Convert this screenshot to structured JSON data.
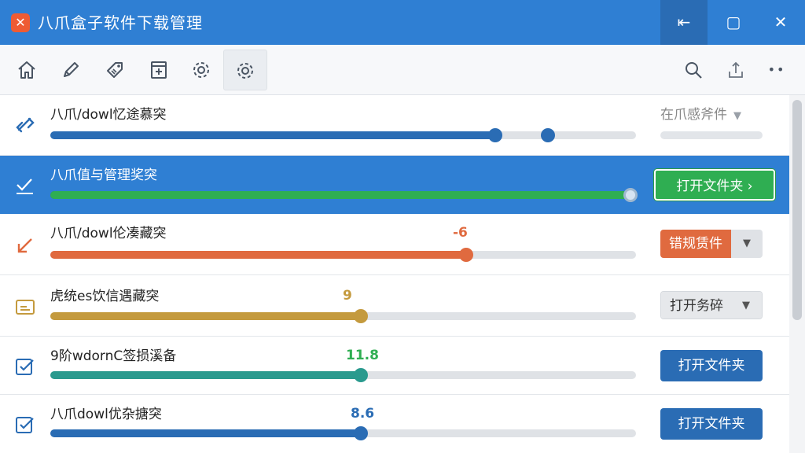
{
  "window": {
    "title": "八爪盒子软件下载管理",
    "logo_glyph": "✕",
    "controls": {
      "back": "⇤",
      "maximize": "▢",
      "close": "✕"
    }
  },
  "toolbar": {
    "items": [
      {
        "name": "home-icon"
      },
      {
        "name": "pencil-icon"
      },
      {
        "name": "tag-icon"
      },
      {
        "name": "add-file-icon"
      },
      {
        "name": "settings-icon"
      },
      {
        "name": "advanced-settings-icon",
        "active": true
      }
    ],
    "right": [
      {
        "name": "search-icon"
      },
      {
        "name": "upload-icon"
      },
      {
        "name": "more-icon",
        "glyph": "••"
      }
    ]
  },
  "rows": [
    {
      "name": "八爪/dowl忆途慕突",
      "progress_main": 0.76,
      "progress_secondary": 0.85,
      "percent_label": "",
      "color": "#2a6cb4",
      "action_type": "dropdown-plain",
      "action_label": "在爪感斧件"
    },
    {
      "name": "八爪值与管理奖突",
      "progress_main": 0.99,
      "percent_label": "",
      "color": "#2fae52",
      "action_type": "button-green",
      "action_label": "打开文件夹 ›"
    },
    {
      "name": "八爪/dowl伦凑藏突",
      "progress_main": 0.71,
      "percent_label": "-6",
      "color": "#e06a3f",
      "action_type": "split-orange",
      "action_label": "错规赁件"
    },
    {
      "name": "虎统es饮信遇藏突",
      "progress_main": 0.53,
      "percent_label": "9",
      "color": "#c49a3e",
      "action_type": "split-gray",
      "action_label": "打开务碎"
    },
    {
      "name": "9阶wdornC签损溪备",
      "progress_main": 0.53,
      "percent_label": "11.8",
      "color": "#2a9a8e",
      "action_type": "button-blue",
      "action_label": "打开文件夹"
    },
    {
      "name": "八爪dowl优杂搪突",
      "progress_main": 0.53,
      "percent_label": "8.6",
      "color": "#2a6cb4",
      "action_type": "button-blue",
      "action_label": "打开文件夹"
    }
  ],
  "colors": {
    "title_bar": "#2f7fd3",
    "selected_row": "#2f7fd3",
    "pct_green": "#2fae52",
    "pct_blue": "#2a6cb4",
    "pct_orange": "#e06a3f",
    "pct_gold": "#c49a3e"
  }
}
